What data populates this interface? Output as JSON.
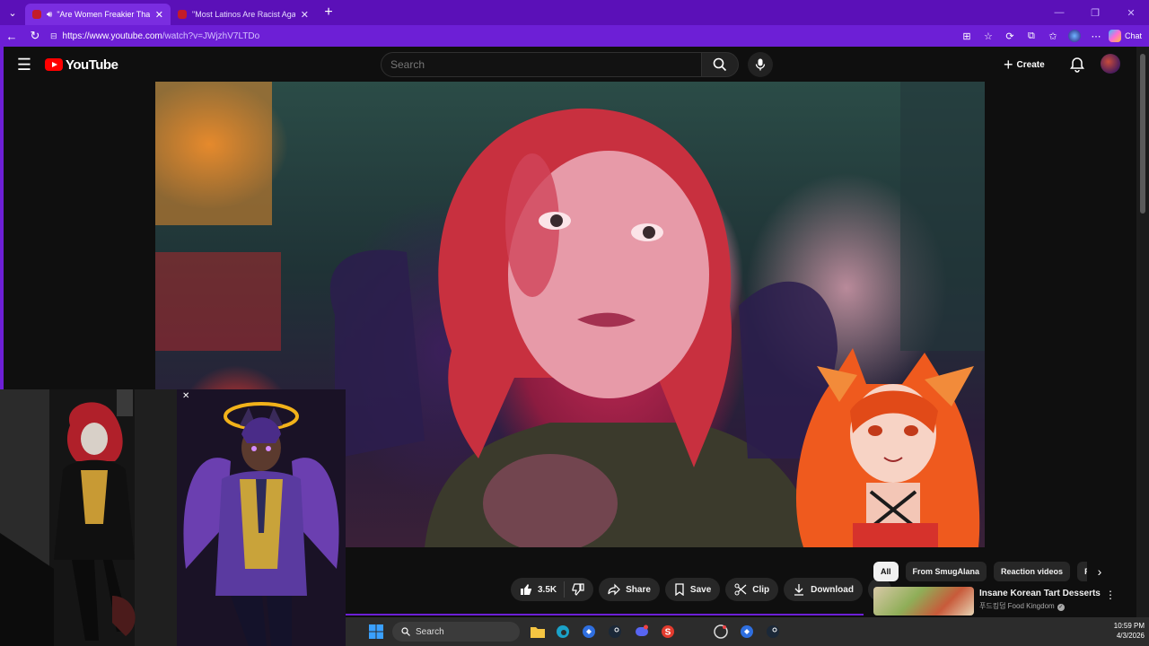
{
  "browser": {
    "tabs": [
      {
        "title": "\"Are Women Freakier Than M",
        "active": true,
        "audio": true
      },
      {
        "title": "\"Most Latinos Are Racist Against I",
        "active": false,
        "audio": false
      }
    ],
    "url_host": "https://www.youtube.com",
    "url_path": "/watch?v=JWjzhV7LTDo",
    "chat_label": "Chat"
  },
  "youtube": {
    "logo_text": "YouTube",
    "search_placeholder": "Search",
    "create_label": "Create"
  },
  "actions": {
    "likes": "3.5K",
    "share": "Share",
    "save": "Save",
    "clip": "Clip",
    "download": "Download"
  },
  "chips": [
    "All",
    "From SmugAlana",
    "Reaction videos",
    "Re"
  ],
  "recommendation": {
    "title": "Insane Korean Tart Desserts",
    "channel": "푸드킹덤 Food Kingdom"
  },
  "taskbar": {
    "search_label": "Search",
    "time": "10:59 PM",
    "date": "4/3/2026"
  },
  "colors": {
    "browser_accent": "#6d1fd6",
    "youtube_red": "#ff0000",
    "page_bg": "#0f0f0f"
  }
}
